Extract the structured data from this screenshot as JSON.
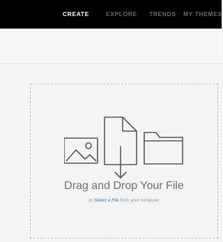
{
  "nav": {
    "items": [
      {
        "label": "CREATE",
        "active": true
      },
      {
        "label": "EXPLORE",
        "active": false
      },
      {
        "label": "TRENDS",
        "active": false
      },
      {
        "label": "MY THEMES",
        "active": false
      }
    ]
  },
  "upload": {
    "title": "Drag and Drop Your File",
    "subtitle_prefix": "or",
    "select_link": "Select a File",
    "subtitle_suffix": "from your computer"
  },
  "icons": [
    "image-icon",
    "file-download-icon",
    "folder-icon"
  ],
  "colors": {
    "nav_bg": "#000000",
    "nav_active": "#ffffff",
    "nav_muted": "#6a6a6a",
    "link": "#2a72c9",
    "icon_stroke": "#555555"
  }
}
